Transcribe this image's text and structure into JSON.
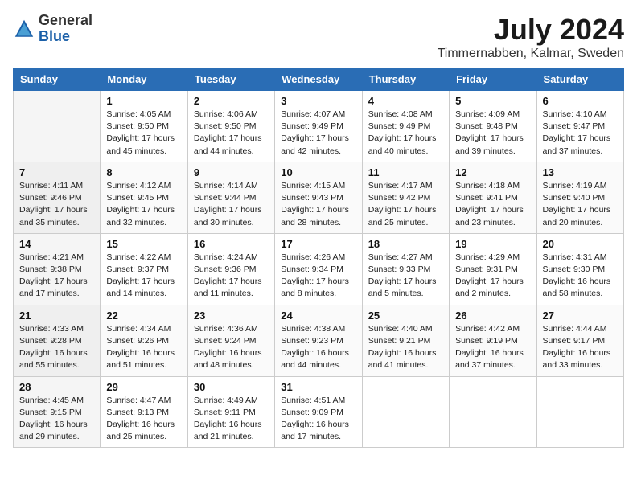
{
  "header": {
    "logo_general": "General",
    "logo_blue": "Blue",
    "month_title": "July 2024",
    "location": "Timmernabben, Kalmar, Sweden"
  },
  "days_of_week": [
    "Sunday",
    "Monday",
    "Tuesday",
    "Wednesday",
    "Thursday",
    "Friday",
    "Saturday"
  ],
  "weeks": [
    [
      {
        "day": "",
        "sunrise": "",
        "sunset": "",
        "daylight": ""
      },
      {
        "day": "1",
        "sunrise": "Sunrise: 4:05 AM",
        "sunset": "Sunset: 9:50 PM",
        "daylight": "Daylight: 17 hours and 45 minutes."
      },
      {
        "day": "2",
        "sunrise": "Sunrise: 4:06 AM",
        "sunset": "Sunset: 9:50 PM",
        "daylight": "Daylight: 17 hours and 44 minutes."
      },
      {
        "day": "3",
        "sunrise": "Sunrise: 4:07 AM",
        "sunset": "Sunset: 9:49 PM",
        "daylight": "Daylight: 17 hours and 42 minutes."
      },
      {
        "day": "4",
        "sunrise": "Sunrise: 4:08 AM",
        "sunset": "Sunset: 9:49 PM",
        "daylight": "Daylight: 17 hours and 40 minutes."
      },
      {
        "day": "5",
        "sunrise": "Sunrise: 4:09 AM",
        "sunset": "Sunset: 9:48 PM",
        "daylight": "Daylight: 17 hours and 39 minutes."
      },
      {
        "day": "6",
        "sunrise": "Sunrise: 4:10 AM",
        "sunset": "Sunset: 9:47 PM",
        "daylight": "Daylight: 17 hours and 37 minutes."
      }
    ],
    [
      {
        "day": "7",
        "sunrise": "Sunrise: 4:11 AM",
        "sunset": "Sunset: 9:46 PM",
        "daylight": "Daylight: 17 hours and 35 minutes."
      },
      {
        "day": "8",
        "sunrise": "Sunrise: 4:12 AM",
        "sunset": "Sunset: 9:45 PM",
        "daylight": "Daylight: 17 hours and 32 minutes."
      },
      {
        "day": "9",
        "sunrise": "Sunrise: 4:14 AM",
        "sunset": "Sunset: 9:44 PM",
        "daylight": "Daylight: 17 hours and 30 minutes."
      },
      {
        "day": "10",
        "sunrise": "Sunrise: 4:15 AM",
        "sunset": "Sunset: 9:43 PM",
        "daylight": "Daylight: 17 hours and 28 minutes."
      },
      {
        "day": "11",
        "sunrise": "Sunrise: 4:17 AM",
        "sunset": "Sunset: 9:42 PM",
        "daylight": "Daylight: 17 hours and 25 minutes."
      },
      {
        "day": "12",
        "sunrise": "Sunrise: 4:18 AM",
        "sunset": "Sunset: 9:41 PM",
        "daylight": "Daylight: 17 hours and 23 minutes."
      },
      {
        "day": "13",
        "sunrise": "Sunrise: 4:19 AM",
        "sunset": "Sunset: 9:40 PM",
        "daylight": "Daylight: 17 hours and 20 minutes."
      }
    ],
    [
      {
        "day": "14",
        "sunrise": "Sunrise: 4:21 AM",
        "sunset": "Sunset: 9:38 PM",
        "daylight": "Daylight: 17 hours and 17 minutes."
      },
      {
        "day": "15",
        "sunrise": "Sunrise: 4:22 AM",
        "sunset": "Sunset: 9:37 PM",
        "daylight": "Daylight: 17 hours and 14 minutes."
      },
      {
        "day": "16",
        "sunrise": "Sunrise: 4:24 AM",
        "sunset": "Sunset: 9:36 PM",
        "daylight": "Daylight: 17 hours and 11 minutes."
      },
      {
        "day": "17",
        "sunrise": "Sunrise: 4:26 AM",
        "sunset": "Sunset: 9:34 PM",
        "daylight": "Daylight: 17 hours and 8 minutes."
      },
      {
        "day": "18",
        "sunrise": "Sunrise: 4:27 AM",
        "sunset": "Sunset: 9:33 PM",
        "daylight": "Daylight: 17 hours and 5 minutes."
      },
      {
        "day": "19",
        "sunrise": "Sunrise: 4:29 AM",
        "sunset": "Sunset: 9:31 PM",
        "daylight": "Daylight: 17 hours and 2 minutes."
      },
      {
        "day": "20",
        "sunrise": "Sunrise: 4:31 AM",
        "sunset": "Sunset: 9:30 PM",
        "daylight": "Daylight: 16 hours and 58 minutes."
      }
    ],
    [
      {
        "day": "21",
        "sunrise": "Sunrise: 4:33 AM",
        "sunset": "Sunset: 9:28 PM",
        "daylight": "Daylight: 16 hours and 55 minutes."
      },
      {
        "day": "22",
        "sunrise": "Sunrise: 4:34 AM",
        "sunset": "Sunset: 9:26 PM",
        "daylight": "Daylight: 16 hours and 51 minutes."
      },
      {
        "day": "23",
        "sunrise": "Sunrise: 4:36 AM",
        "sunset": "Sunset: 9:24 PM",
        "daylight": "Daylight: 16 hours and 48 minutes."
      },
      {
        "day": "24",
        "sunrise": "Sunrise: 4:38 AM",
        "sunset": "Sunset: 9:23 PM",
        "daylight": "Daylight: 16 hours and 44 minutes."
      },
      {
        "day": "25",
        "sunrise": "Sunrise: 4:40 AM",
        "sunset": "Sunset: 9:21 PM",
        "daylight": "Daylight: 16 hours and 41 minutes."
      },
      {
        "day": "26",
        "sunrise": "Sunrise: 4:42 AM",
        "sunset": "Sunset: 9:19 PM",
        "daylight": "Daylight: 16 hours and 37 minutes."
      },
      {
        "day": "27",
        "sunrise": "Sunrise: 4:44 AM",
        "sunset": "Sunset: 9:17 PM",
        "daylight": "Daylight: 16 hours and 33 minutes."
      }
    ],
    [
      {
        "day": "28",
        "sunrise": "Sunrise: 4:45 AM",
        "sunset": "Sunset: 9:15 PM",
        "daylight": "Daylight: 16 hours and 29 minutes."
      },
      {
        "day": "29",
        "sunrise": "Sunrise: 4:47 AM",
        "sunset": "Sunset: 9:13 PM",
        "daylight": "Daylight: 16 hours and 25 minutes."
      },
      {
        "day": "30",
        "sunrise": "Sunrise: 4:49 AM",
        "sunset": "Sunset: 9:11 PM",
        "daylight": "Daylight: 16 hours and 21 minutes."
      },
      {
        "day": "31",
        "sunrise": "Sunrise: 4:51 AM",
        "sunset": "Sunset: 9:09 PM",
        "daylight": "Daylight: 16 hours and 17 minutes."
      },
      {
        "day": "",
        "sunrise": "",
        "sunset": "",
        "daylight": ""
      },
      {
        "day": "",
        "sunrise": "",
        "sunset": "",
        "daylight": ""
      },
      {
        "day": "",
        "sunrise": "",
        "sunset": "",
        "daylight": ""
      }
    ]
  ]
}
